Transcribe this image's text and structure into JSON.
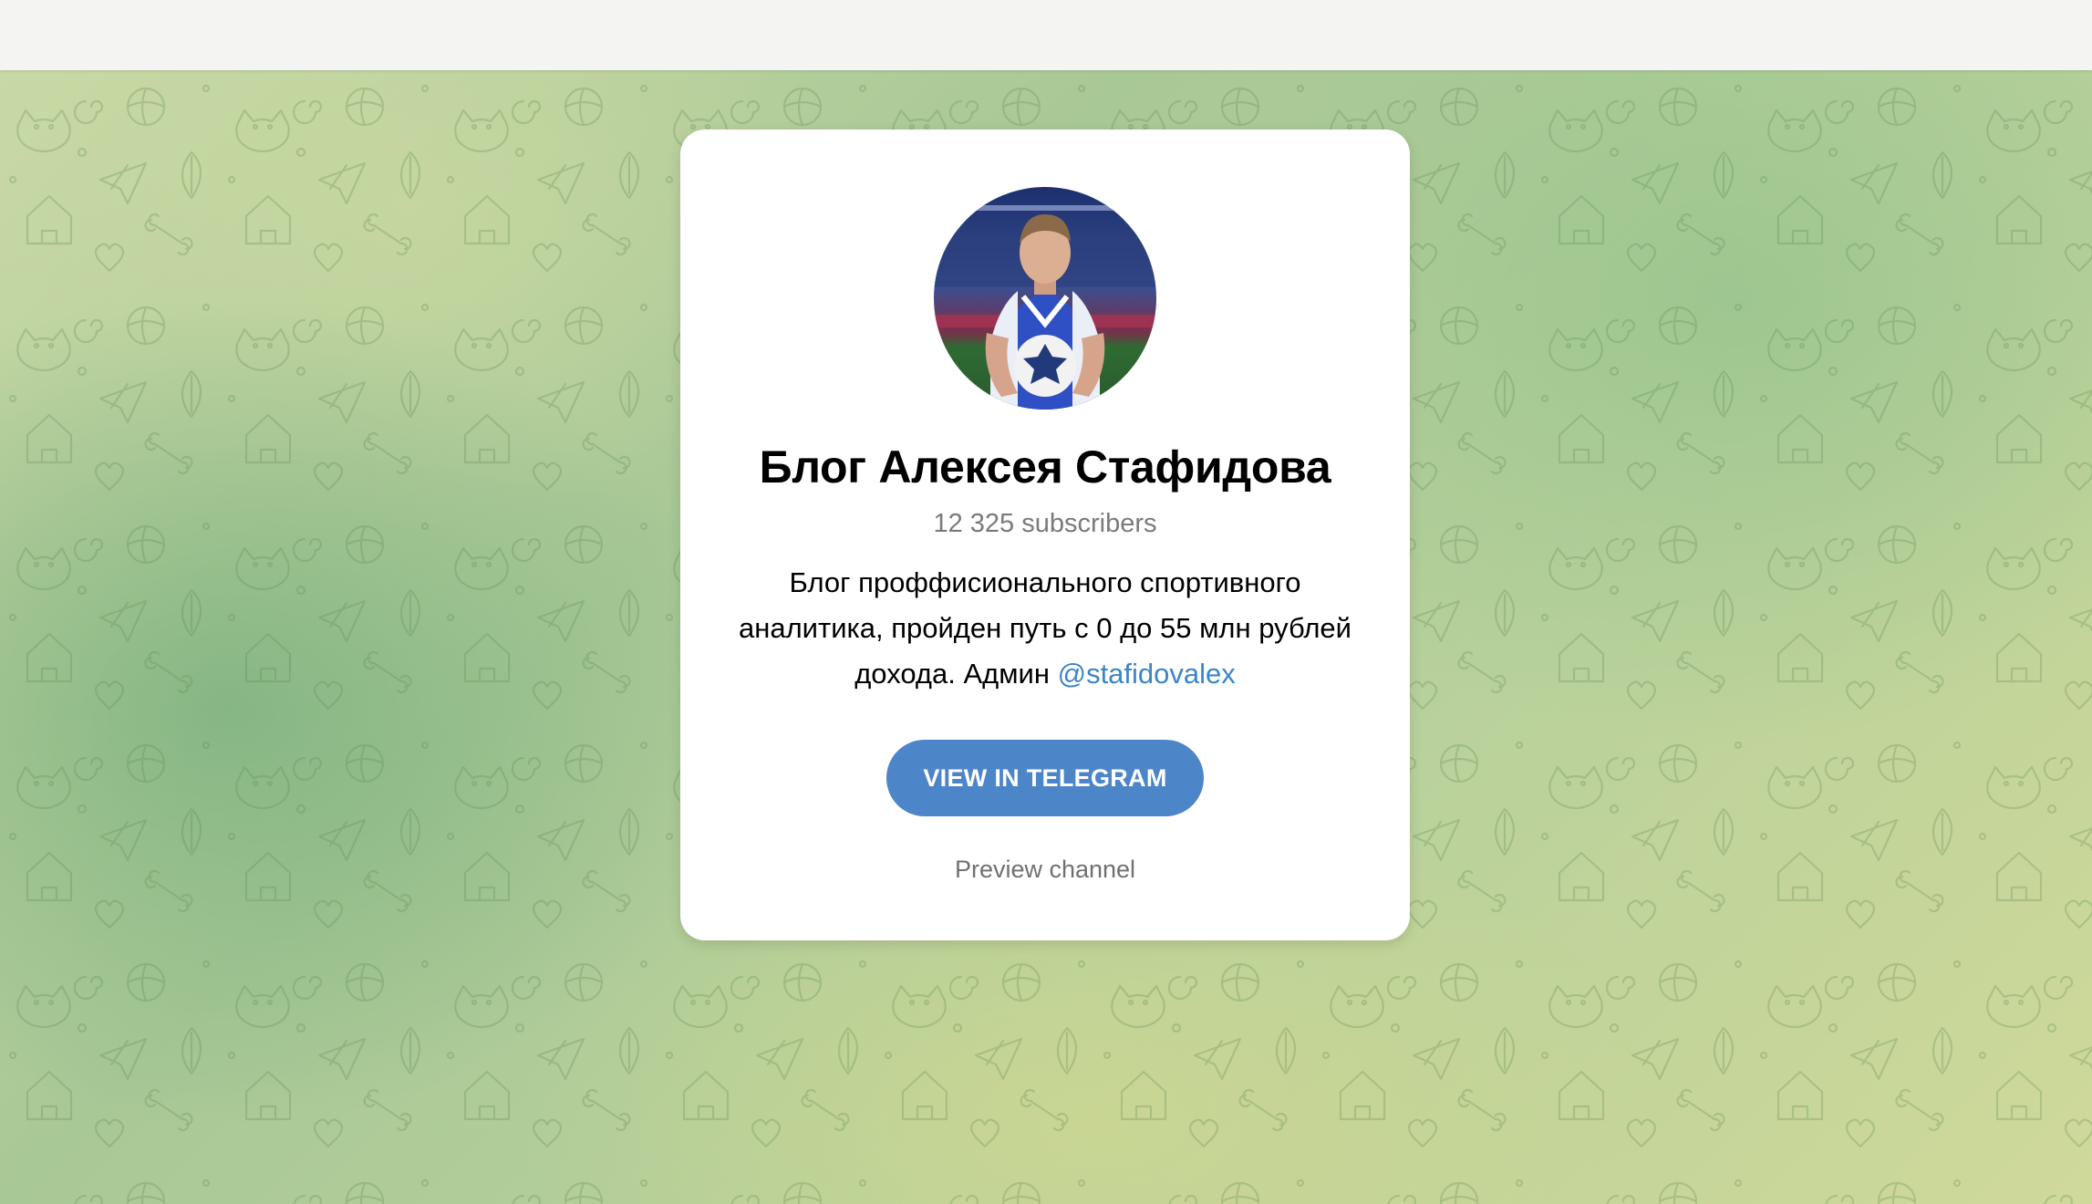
{
  "channel": {
    "title": "Блог Алексея Стафидова",
    "subscribers": "12 325 subscribers",
    "description_text": "Блог проффисионального спортивного аналитика, пройден путь с 0 до 55 млн рублей дохода. Админ ",
    "admin_link": "@stafidovalex"
  },
  "actions": {
    "view_button": "VIEW IN TELEGRAM",
    "preview_link": "Preview channel"
  },
  "colors": {
    "button": "#4d85c9",
    "link": "#3c85c9",
    "background_top": "#c9d9a5",
    "background_bottom": "#cfd99a"
  }
}
